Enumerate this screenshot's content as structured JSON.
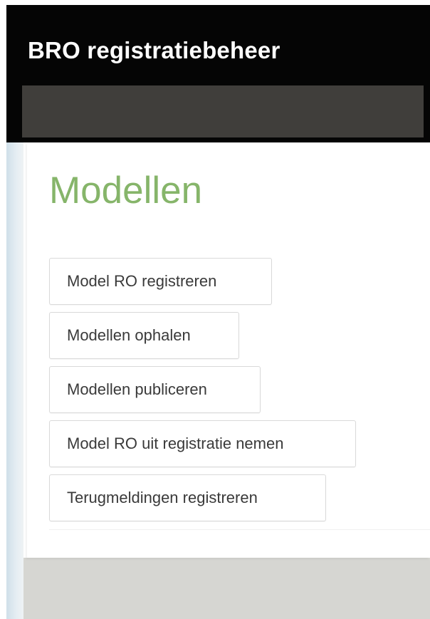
{
  "header": {
    "app_title": "BRO registratiebeheer"
  },
  "main": {
    "page_title": "Modellen",
    "actions": [
      {
        "label": "Model RO registreren"
      },
      {
        "label": "Modellen ophalen"
      },
      {
        "label": "Modellen publiceren"
      },
      {
        "label": "Model RO uit registratie nemen"
      },
      {
        "label": "Terugmeldingen registreren"
      }
    ]
  },
  "colors": {
    "header_bg": "#050505",
    "nav_bg": "#403e3b",
    "title_green": "#86b56a",
    "button_text": "#3a3a3a",
    "button_border": "#d9d9d9",
    "footer_bg": "#d6d6d2"
  }
}
